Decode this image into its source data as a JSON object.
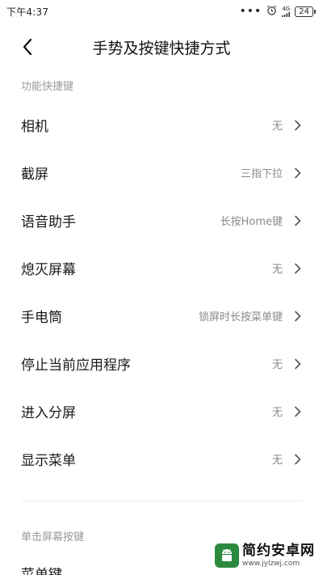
{
  "status_bar": {
    "time": "下午4:37",
    "dots": "•••",
    "network": "4G",
    "battery": "24"
  },
  "header": {
    "title": "手势及按键快捷方式"
  },
  "sections": [
    {
      "label": "功能快捷键",
      "items": [
        {
          "label": "相机",
          "value": "无"
        },
        {
          "label": "截屏",
          "value": "三指下拉"
        },
        {
          "label": "语音助手",
          "value": "长按Home键"
        },
        {
          "label": "熄灭屏幕",
          "value": "无"
        },
        {
          "label": "手电筒",
          "value": "锁屏时长按菜单键"
        },
        {
          "label": "停止当前应用程序",
          "value": "无"
        },
        {
          "label": "进入分屏",
          "value": "无"
        },
        {
          "label": "显示菜单",
          "value": "无"
        }
      ]
    },
    {
      "label": "单击屏幕按键",
      "items": [
        {
          "label": "菜单键",
          "value": ""
        }
      ]
    }
  ],
  "watermark": {
    "title": "简约安卓网",
    "url": "www.jylzwj.com"
  },
  "icons": {
    "back": "back-arrow-icon",
    "chevron": "chevron-right-icon",
    "alarm": "alarm-icon"
  }
}
